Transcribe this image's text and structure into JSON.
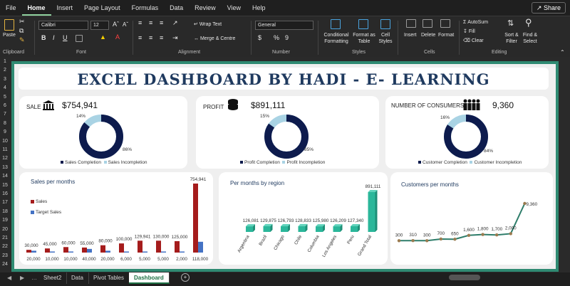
{
  "menu": [
    "File",
    "Home",
    "Insert",
    "Page Layout",
    "Formulas",
    "Data",
    "Review",
    "View",
    "Help"
  ],
  "share_label": "Share",
  "ribbon": {
    "paste": "Paste",
    "clipboard_label": "Clipboard",
    "font_name": "Calibri",
    "font_size": "12",
    "font_label": "Font",
    "bold": "B",
    "italic": "I",
    "underline": "U",
    "wrap_text": "Wrap Text",
    "merge_center": "Merge & Centre",
    "alignment_label": "Alignment",
    "number_format": "General",
    "number_label": "Number",
    "currency": "$",
    "percent": "%",
    "comma": "9",
    "cond_format": [
      "Conditional",
      "Formatting"
    ],
    "format_table": [
      "Format as",
      "Table"
    ],
    "cell_styles": [
      "Cell",
      "Styles"
    ],
    "styles_label": "Styles",
    "insert": "Insert",
    "delete": "Delete",
    "format": "Format",
    "cells_label": "Cells",
    "autosum": "AutoSum",
    "fill": "Fill",
    "clear": "Clear",
    "sort_filter": [
      "Sort &",
      "Filter"
    ],
    "find_select": [
      "Find &",
      "Select"
    ],
    "editing_label": "Editing"
  },
  "row_numbers": [
    "1",
    "2",
    "3",
    "4",
    "5",
    "6",
    "7",
    "8",
    "9",
    "10",
    "11",
    "12",
    "13",
    "14",
    "15",
    "16",
    "17",
    "18",
    "19",
    "20",
    "21",
    "22",
    "23",
    "24"
  ],
  "dashboard_title": "EXCEL DASHBOARD BY HADI - E- LEARNING",
  "kpis": [
    {
      "label": "SALE",
      "value": "$754,941",
      "pct_small": "14%",
      "pct_big": "86%",
      "legend_a": "Sales Completion",
      "legend_b": "Sales Incompletion",
      "ratio": 0.86
    },
    {
      "label": "PROFIT",
      "value": "$891,111",
      "pct_small": "15%",
      "pct_big": "85%",
      "legend_a": "Profit Completion",
      "legend_b": "Profit Incompletion",
      "ratio": 0.85
    },
    {
      "label": "NUMBER OF CONSUMERS",
      "value": "9,360",
      "pct_small": "16%",
      "pct_big": "84%",
      "legend_a": "Customer Completion",
      "legend_b": "Customer Incompletion",
      "ratio": 0.84
    }
  ],
  "colors": {
    "donut_main": "#0d1b4d",
    "donut_rest": "#a9d3e4",
    "sales": "#a51c1c",
    "target": "#4472c4",
    "region": "#2bb79a",
    "line": "#2e7d6a",
    "marker": "#9a7b4f",
    "frame": "#2f8a72"
  },
  "chart_data": [
    {
      "type": "bar",
      "title": "Sales per months",
      "legend": [
        "Sales",
        "Target Sales"
      ],
      "series": [
        {
          "name": "Sales",
          "values": [
            30000,
            45000,
            60000,
            55000,
            80000,
            100000,
            129941,
            130000,
            125000,
            754941
          ]
        },
        {
          "name": "Target Sales",
          "values": [
            20000,
            10000,
            10000,
            40000,
            20000,
            6000,
            5000,
            5000,
            2000,
            118000
          ]
        }
      ],
      "labels_sales": [
        "30,000",
        "45,000",
        "60,000",
        "55,000",
        "80,000",
        "100,000",
        "129,941",
        "130,000",
        "125,000",
        "754,941"
      ],
      "labels_target": [
        "20,000",
        "10,000",
        "10,000",
        "40,000",
        "20,000",
        "6,000",
        "5,000",
        "5,000",
        "2,000",
        "118,000"
      ]
    },
    {
      "type": "bar",
      "title": "Per months by region",
      "categories": [
        "Argentina",
        "Brazil",
        "Chicago",
        "Chile",
        "Columbia",
        "Los Angeles",
        "Peru",
        "Grand Total"
      ],
      "values": [
        126081,
        129875,
        126793,
        128833,
        125980,
        126209,
        127340,
        891111
      ],
      "labels": [
        "126,081",
        "129,875",
        "126,793",
        "128,833",
        "125,980",
        "126,209",
        "127,340",
        "891,111"
      ]
    },
    {
      "type": "line",
      "title": "Customers per months",
      "values": [
        300,
        310,
        300,
        700,
        650,
        1600,
        1800,
        1700,
        2000,
        9360
      ],
      "labels": [
        "300",
        "310",
        "300",
        "700",
        "650",
        "1,600",
        "1,800",
        "1,700",
        "2,000",
        "9,360"
      ]
    }
  ],
  "sheet_tabs": [
    "Sheet2",
    "Data",
    "Pivot Tables",
    "Dashboard"
  ],
  "active_sheet": "Dashboard"
}
